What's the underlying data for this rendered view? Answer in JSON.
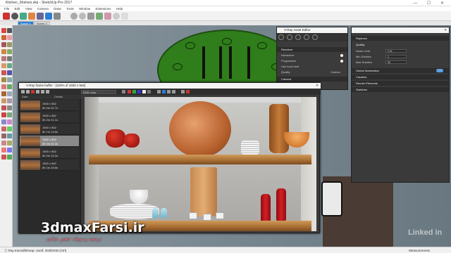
{
  "window": {
    "title": "Kitchen_Shelves.skp - SketchUp Pro 2017",
    "controls": "—  ☐  ✕"
  },
  "menu": [
    "File",
    "Edit",
    "View",
    "Camera",
    "Draw",
    "Tools",
    "Window",
    "Extensions",
    "Help"
  ],
  "scene_tabs": [
    "Scene 1",
    "Scene 2"
  ],
  "frame_buffer": {
    "title": "V-Ray frame buffer - [100% of 1500 x 562]",
    "channel_select": "RGB color",
    "history_headers": [
      "Date",
      "Details"
    ],
    "history_items": [
      {
        "line1": "1500 x 562",
        "line2": "5h 0m 31.7s",
        "selected": false
      },
      {
        "line1": "1500 x 562",
        "line2": "5h 2m 21.1s",
        "selected": false
      },
      {
        "line1": "1500 x 562",
        "line2": "5h 1m 14.5s",
        "selected": false
      },
      {
        "line1": "1500 x 562",
        "line2": "5h 0m 52.3s",
        "selected": true
      },
      {
        "line1": "1500 x 562",
        "line2": "5h 2m 10.2s",
        "selected": false
      },
      {
        "line1": "1500 x 562",
        "line2": "5h 1m 28.6s",
        "selected": false
      }
    ]
  },
  "vray_asset_editor": {
    "title": "V-Ray Asset Editor",
    "sections": [
      {
        "label": "Renderer",
        "header": true
      },
      {
        "label": "Interactive",
        "header": false
      },
      {
        "label": "Progressive",
        "header": false
      },
      {
        "label": "Use local host",
        "header": false
      },
      {
        "label": "Quality",
        "header": false
      },
      {
        "label": "Camera",
        "header": true
      }
    ],
    "quality_value": "Custom"
  },
  "settings": {
    "title": "Raytrace",
    "quality_heading": "Quality",
    "fields": [
      {
        "label": "Noise Limit",
        "value": "0.01"
      },
      {
        "label": "Min Subdivs",
        "value": "1"
      },
      {
        "label": "Max Subdivs",
        "value": "30"
      }
    ],
    "collapsed": [
      "Global Illumination",
      "Caustics",
      "Render Elements",
      "Switches"
    ]
  },
  "status": {
    "text": "Ⓘ  Ray traced/bitmap: Used: 3GB/4GB (Ctrl)",
    "measurements": "Measurements"
  },
  "watermark": {
    "brand": "3dmaxFarsi.ir",
    "sub": "ترجمه و دوبله: جعفر عبادی",
    "linkedin": "Linked in"
  },
  "colors": {
    "accent": "#2a7fd4",
    "plate_green": "#2f7d1b",
    "toggle_on": "#5fa0e0",
    "brand_subtitle": "#ff6b7a"
  }
}
